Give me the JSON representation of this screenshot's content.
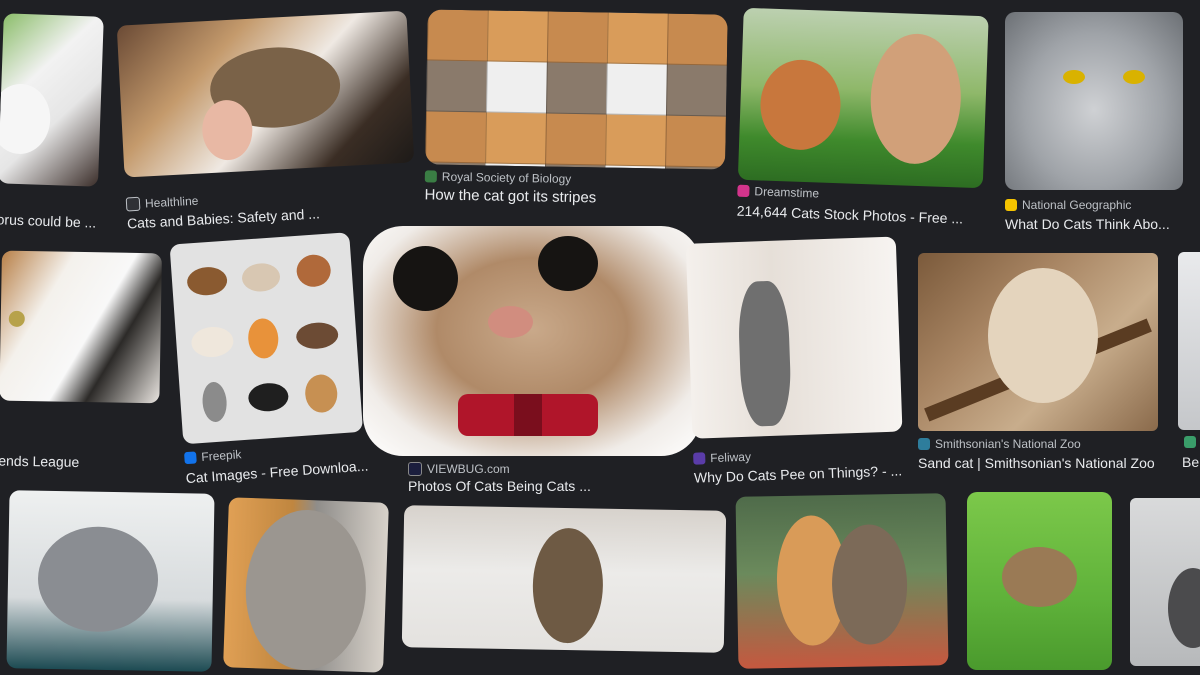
{
  "results": [
    {
      "id": "r1",
      "source": "",
      "title": "orus could be ..."
    },
    {
      "id": "r2",
      "source": "Healthline",
      "title": "Cats and Babies: Safety and ..."
    },
    {
      "id": "r3",
      "source": "Royal Society of Biology",
      "title": "How the cat got its stripes"
    },
    {
      "id": "r4",
      "source": "Dreamstime",
      "title": "214,644 Cats Stock Photos - Free ..."
    },
    {
      "id": "r5",
      "source": "National Geographic",
      "title": "What Do Cats Think Abo..."
    },
    {
      "id": "r6",
      "source": "",
      "title": "ends League"
    },
    {
      "id": "r7",
      "source": "Freepik",
      "title": "Cat Images - Free Downloa..."
    },
    {
      "id": "r8",
      "source": "VIEWBUG.com",
      "title": "Photos Of Cats Being Cats ..."
    },
    {
      "id": "r9",
      "source": "Feliway",
      "title": "Why Do Cats Pee on Things? - ..."
    },
    {
      "id": "r10",
      "source": "Smithsonian's National Zoo",
      "title": "Sand cat | Smithsonian's National Zoo"
    },
    {
      "id": "r11",
      "source": "",
      "title": "Be"
    }
  ],
  "colors": {
    "background": "#1f2024",
    "text": "#e8eaed",
    "source_text": "#bdc1c6",
    "healthline": "#2f3136",
    "rsb": "#3a7d44",
    "dreamstime": "#d3348c",
    "natgeo": "#f5c400",
    "freepik": "#1273eb",
    "viewbug": "#1b1e3d",
    "feliway": "#5a3ca8",
    "smithsonian": "#2e7d9c"
  }
}
